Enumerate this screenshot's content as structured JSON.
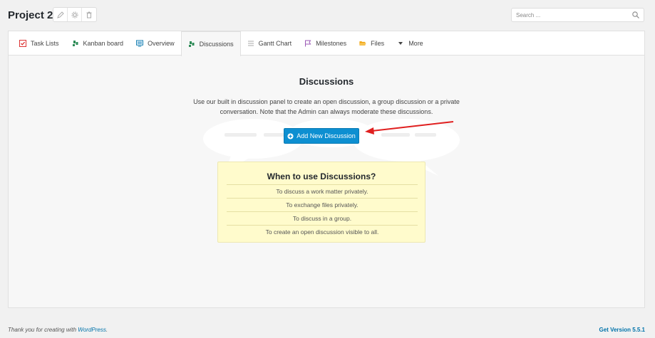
{
  "header": {
    "project_title": "Project 2",
    "tools": [
      {
        "icon": "pencil-icon"
      },
      {
        "icon": "gear-icon"
      },
      {
        "icon": "trash-icon"
      }
    ],
    "search": {
      "placeholder": "Search ...",
      "value": ""
    }
  },
  "tabs": [
    {
      "label": "Task Lists",
      "icon": "task-list-icon",
      "color": "#dc3232",
      "active": false
    },
    {
      "label": "Kanban board",
      "icon": "kanban-icon",
      "color": "#2e8b57",
      "active": false
    },
    {
      "label": "Overview",
      "icon": "monitor-icon",
      "color": "#0073aa",
      "active": false
    },
    {
      "label": "Discussions",
      "icon": "discussions-icon",
      "color": "#2e8b57",
      "active": true
    },
    {
      "label": "Gantt Chart",
      "icon": "gantt-icon",
      "color": "#999999",
      "active": false
    },
    {
      "label": "Milestones",
      "icon": "flag-icon",
      "color": "#9b59b6",
      "active": false
    },
    {
      "label": "Files",
      "icon": "folder-icon",
      "color": "#f0a30a",
      "active": false
    },
    {
      "label": "More",
      "icon": "caret-down-icon",
      "color": "#444444",
      "active": false
    }
  ],
  "discussions": {
    "title": "Discussions",
    "description": "Use our built in discussion panel to create an open discussion, a group discussion or a private conversation. Note that the Admin can always moderate these discussions.",
    "add_button_label": "Add New Discussion"
  },
  "when_to_use": {
    "title": "When to use Discussions?",
    "items": [
      "To discuss a work matter privately.",
      "To exchange files privately.",
      "To discuss in a group.",
      "To create an open discussion visible to all."
    ]
  },
  "footer": {
    "thanks_prefix": "Thank you for creating with ",
    "thanks_link": "WordPress",
    "thanks_suffix": ".",
    "version": "Get Version 5.5.1"
  },
  "colors": {
    "accent": "#0d8fd1",
    "arrow": "#e02020",
    "note_bg": "#fffbcc"
  }
}
